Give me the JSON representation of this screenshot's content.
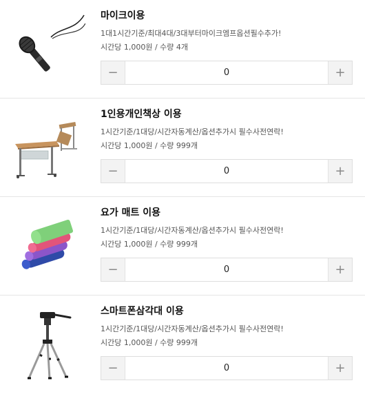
{
  "items": [
    {
      "title": "마이크이용",
      "description": "1대1시간기준/최대4대/3대부터마이크엠프옵션필수추가!",
      "price": "시간당 1,000원 / 수량 4개",
      "quantity": "0",
      "image_icon": "microphone-icon",
      "minus_label": "−",
      "plus_label": "+"
    },
    {
      "title": "1인용개인책상 이용",
      "description": "1시간기준/1대당/시간자동계산/옵션추가시 필수사전연락!",
      "price": "시간당 1,000원 / 수량 999개",
      "quantity": "0",
      "image_icon": "desk-icon",
      "minus_label": "−",
      "plus_label": "+"
    },
    {
      "title": "요가 매트 이용",
      "description": "1시간기준/1대당/시간자동계산/옵션추가시 필수사전연락!",
      "price": "시간당 1,000원 / 수량 999개",
      "quantity": "0",
      "image_icon": "yoga-mat-icon",
      "minus_label": "−",
      "plus_label": "+"
    },
    {
      "title": "스마트폰삼각대 이용",
      "description": "1시간기준/1대당/시간자동계산/옵션추가시 필수사전연락!",
      "price": "시간당 1,000원 / 수량 999개",
      "quantity": "0",
      "image_icon": "tripod-icon",
      "minus_label": "−",
      "plus_label": "+"
    }
  ]
}
